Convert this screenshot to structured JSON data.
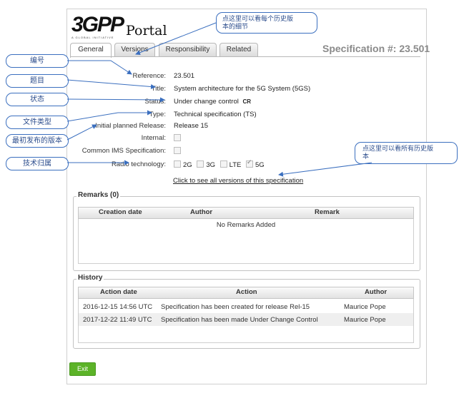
{
  "logo": {
    "mark": "3GPP",
    "tagline": "A GLOBAL INITIATIVE",
    "portal": "Portal"
  },
  "spec_number": "Specification #: 23.501",
  "tabs": [
    {
      "label": "General",
      "active": true
    },
    {
      "label": "Versions",
      "active": false
    },
    {
      "label": "Responsibility",
      "active": false
    },
    {
      "label": "Related",
      "active": false
    }
  ],
  "fields": {
    "reference": {
      "label": "Reference:",
      "value": "23.501"
    },
    "title": {
      "label": "Title:",
      "value": "System architecture for the 5G System (5GS)"
    },
    "status": {
      "label": "Status:",
      "value": "Under change control",
      "badge": "CR"
    },
    "type": {
      "label": "Type:",
      "value": "Technical specification (TS)"
    },
    "release": {
      "label": "Initial planned Release:",
      "value": "Release 15"
    },
    "internal": {
      "label": "Internal:",
      "checked": false
    },
    "ims": {
      "label": "Common IMS Specification:",
      "checked": false
    },
    "radio": {
      "label": "Radio technology:",
      "options": [
        {
          "label": "2G",
          "checked": false
        },
        {
          "label": "3G",
          "checked": false
        },
        {
          "label": "LTE",
          "checked": false
        },
        {
          "label": "5G",
          "checked": true
        }
      ]
    }
  },
  "versions_link": "Click to see all versions of this specification",
  "remarks": {
    "legend": "Remarks (0)",
    "columns": [
      "Creation date",
      "Author",
      "Remark"
    ],
    "empty": "No Remarks Added"
  },
  "history": {
    "legend": "History",
    "columns": [
      "Action date",
      "Action",
      "Author"
    ],
    "rows": [
      {
        "date": "2016-12-15 14:56 UTC",
        "action": "Specification has been created for release Rel-15",
        "author": "Maurice Pope"
      },
      {
        "date": "2017-12-22 11:49 UTC",
        "action": "Specification has been made Under Change Control",
        "author": "Maurice Pope"
      }
    ]
  },
  "exit_label": "Exit",
  "callouts": {
    "number": "编号",
    "title": "题目",
    "status": "状态",
    "type": "文件类型",
    "release": "最初发布的版本",
    "tech": "技术归属",
    "details_line1": "点这里可以看每个历史版",
    "details_line2": "本的细节",
    "all_line1": "点这里可以看所有历史版",
    "all_line2": "本"
  },
  "colors": {
    "exit_button": "#5cb328",
    "callout": "#3b6fbf",
    "spec_number": "#8a8a8a"
  }
}
